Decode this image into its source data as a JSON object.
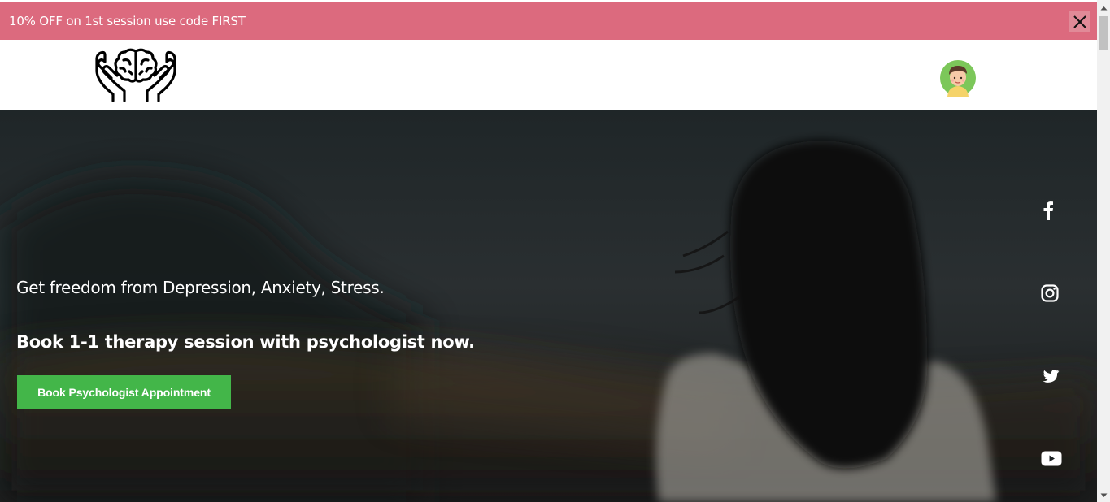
{
  "promo": {
    "text": "10% OFF on 1st session use code FIRST"
  },
  "header": {
    "logo_icon": "brain-in-hands-icon",
    "avatar_icon": "user-avatar-icon"
  },
  "hero": {
    "tagline": "Get freedom from Depression, Anxiety, Stress.",
    "headline": "Book 1-1 therapy session with psychologist now.",
    "cta_label": "Book Psychologist Appointment"
  },
  "social": [
    "facebook-icon",
    "instagram-icon",
    "twitter-icon",
    "youtube-icon"
  ],
  "colors": {
    "promo_bg": "#dc6a7e",
    "cta_bg": "#43b649",
    "avatar_bg": "#7cc75a"
  }
}
